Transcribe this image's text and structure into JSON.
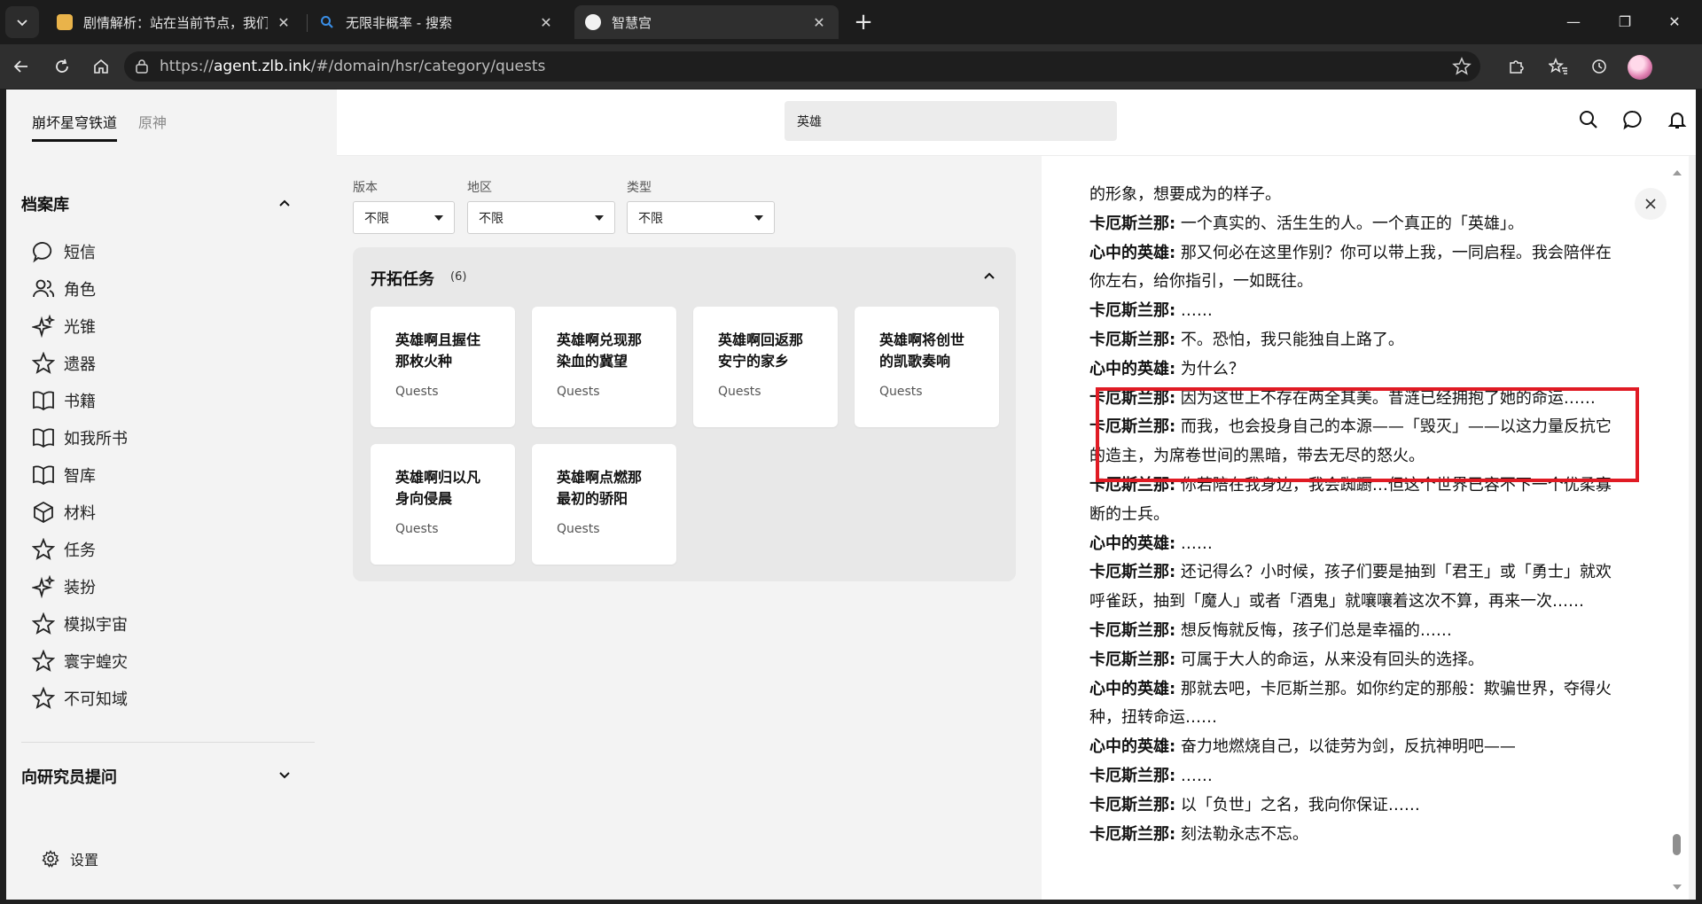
{
  "browser": {
    "tabs": [
      {
        "title": "剧情解析：站在当前节点，我们来",
        "active": false
      },
      {
        "title": "无限非概率 - 搜索",
        "active": false
      },
      {
        "title": "智慧宫",
        "active": true
      }
    ],
    "url_prefix": "https://",
    "url_host": "agent.zlb.ink",
    "url_path": "/#/domain/hsr/category/quests"
  },
  "sidebar": {
    "game_tabs": [
      "崩坏星穹铁道",
      "原神"
    ],
    "archive_heading": "档案库",
    "items": [
      {
        "label": "短信",
        "icon": "message-icon"
      },
      {
        "label": "角色",
        "icon": "people-icon"
      },
      {
        "label": "光锥",
        "icon": "sparkle-icon"
      },
      {
        "label": "遗器",
        "icon": "star-icon"
      },
      {
        "label": "书籍",
        "icon": "book-icon"
      },
      {
        "label": "如我所书",
        "icon": "book-icon"
      },
      {
        "label": "智库",
        "icon": "book-icon"
      },
      {
        "label": "材料",
        "icon": "cube-icon"
      },
      {
        "label": "任务",
        "icon": "star-icon"
      },
      {
        "label": "装扮",
        "icon": "sparkle-icon"
      },
      {
        "label": "模拟宇宙",
        "icon": "star-icon"
      },
      {
        "label": "寰宇蝗灾",
        "icon": "star-icon"
      },
      {
        "label": "不可知域",
        "icon": "star-icon"
      }
    ],
    "ask_heading": "向研究员提问",
    "settings_label": "设置"
  },
  "search": {
    "value": "英雄"
  },
  "filters": [
    {
      "label": "版本",
      "value": "不限"
    },
    {
      "label": "地区",
      "value": "不限"
    },
    {
      "label": "类型",
      "value": "不限"
    }
  ],
  "panel": {
    "title": "开拓任务",
    "count": "(6)",
    "cards": [
      {
        "title": "英雄啊且握住那枚火种",
        "subtitle": "Quests"
      },
      {
        "title": "英雄啊兑现那染血的冀望",
        "subtitle": "Quests"
      },
      {
        "title": "英雄啊回返那安宁的家乡",
        "subtitle": "Quests"
      },
      {
        "title": "英雄啊将创世的凯歌奏响",
        "subtitle": "Quests"
      },
      {
        "title": "英雄啊归以凡身向侵晨",
        "subtitle": "Quests"
      },
      {
        "title": "英雄啊点燃那最初的骄阳",
        "subtitle": "Quests"
      }
    ]
  },
  "dialogue": [
    {
      "speaker": "",
      "text": "的形象，想要成为的样子。"
    },
    {
      "speaker": "卡厄斯兰那:",
      "text": " 一个真实的、活生生的人。一个真正的「英雄」。"
    },
    {
      "speaker": "心中的英雄:",
      "text": " 那又何必在这里作别？你可以带上我，一同启程。我会陪伴在你左右，给你指引，一如既往。"
    },
    {
      "speaker": "卡厄斯兰那:",
      "text": " ……"
    },
    {
      "speaker": "卡厄斯兰那:",
      "text": " 不。恐怕，我只能独自上路了。"
    },
    {
      "speaker": "心中的英雄:",
      "text": " 为什么？"
    },
    {
      "speaker": "卡厄斯兰那:",
      "text": " 因为这世上不存在两全其美。昔涟已经拥抱了她的命运……"
    },
    {
      "speaker": "卡厄斯兰那:",
      "text": " 而我，也会投身自己的本源——「毁灭」——以这力量反抗它的造主，为席卷世间的黑暗，带去无尽的怒火。"
    },
    {
      "speaker": "卡厄斯兰那:",
      "text": " 你若陪在我身边，我会踟蹰…但这个世界已容不下一个优柔寡断的士兵。"
    },
    {
      "speaker": "心中的英雄:",
      "text": " ……"
    },
    {
      "speaker": "卡厄斯兰那:",
      "text": " 还记得么？小时候，孩子们要是抽到「君王」或「勇士」就欢呼雀跃，抽到「魔人」或者「酒鬼」就嚷嚷着这次不算，再来一次……"
    },
    {
      "speaker": "卡厄斯兰那:",
      "text": " 想反悔就反悔，孩子们总是幸福的……"
    },
    {
      "speaker": "卡厄斯兰那:",
      "text": " 可属于大人的命运，从来没有回头的选择。"
    },
    {
      "speaker": "心中的英雄:",
      "text": " 那就去吧，卡厄斯兰那。如你约定的那般：欺骗世界，夺得火种，扭转命运……"
    },
    {
      "speaker": "心中的英雄:",
      "text": " 奋力地燃烧自己，以徒劳为剑，反抗神明吧——"
    },
    {
      "speaker": "卡厄斯兰那:",
      "text": " ……"
    },
    {
      "speaker": "卡厄斯兰那:",
      "text": " 以「负世」之名，我向你保证……"
    },
    {
      "speaker": "卡厄斯兰那:",
      "text": " 刻法勒永志不忘。"
    }
  ],
  "colors": {
    "highlight": "#e01b24",
    "tabbar": "#1c1c1c",
    "page_bg": "#f3f3f3"
  }
}
